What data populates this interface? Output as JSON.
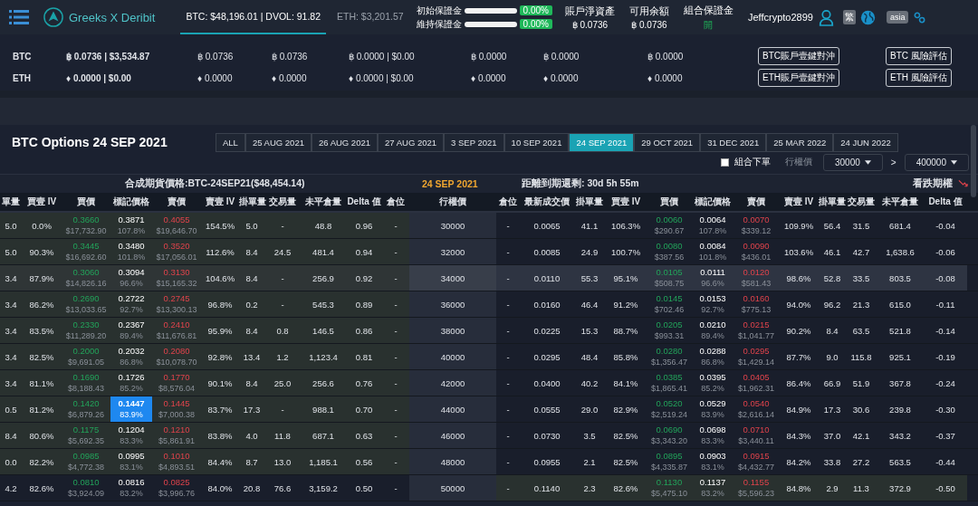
{
  "header": {
    "brand": "Greeks X Deribit",
    "tickers": [
      {
        "label": "BTC: $48,196.01 | DVOL: 91.82",
        "selected": true
      },
      {
        "label": "ETH: $3,201.57",
        "selected": false
      }
    ],
    "margins": [
      {
        "label": "初始保證金",
        "level": 0,
        "value": "0.00%"
      },
      {
        "label": "維持保證金",
        "level": 0,
        "value": "0.00%"
      }
    ],
    "stats": [
      {
        "label": "賬戶淨資產",
        "value": "฿ 0.0736",
        "kind": "plain"
      },
      {
        "label": "可用余額",
        "value": "฿ 0.0736",
        "kind": "plain"
      },
      {
        "label": "組合保證金",
        "value": "開",
        "kind": "status"
      }
    ],
    "user": "Jeffcrypto2899",
    "language": "繁",
    "region": "asia"
  },
  "accounts": [
    {
      "currency": "BTC",
      "cells": [
        "฿ 0.0736 | $3,534.87",
        "฿ 0.0736",
        "฿ 0.0736",
        "฿ 0.0000 | $0.00",
        "฿ 0.0000",
        "฿ 0.0000",
        "฿ 0.0000"
      ],
      "buttons": [
        "BTC賬戶壹鍵對沖",
        "BTC 風險評估"
      ]
    },
    {
      "currency": "ETH",
      "cells": [
        "♦ 0.0000 | $0.00",
        "♦ 0.0000",
        "♦ 0.0000",
        "♦ 0.0000 | $0.00",
        "♦ 0.0000",
        "♦ 0.0000",
        "♦ 0.0000"
      ],
      "buttons": [
        "ETH賬戶壹鍵對沖",
        "ETH 風險評估"
      ]
    }
  ],
  "options": {
    "title": "BTC Options 24 SEP 2021",
    "expiries": [
      {
        "label": "ALL",
        "selected": false
      },
      {
        "label": "25 AUG 2021",
        "selected": false
      },
      {
        "label": "26 AUG 2021",
        "selected": false
      },
      {
        "label": "27 AUG 2021",
        "selected": false
      },
      {
        "label": "3 SEP 2021",
        "selected": false
      },
      {
        "label": "10 SEP 2021",
        "selected": false
      },
      {
        "label": "24 SEP 2021",
        "selected": true
      },
      {
        "label": "29 OCT 2021",
        "selected": false
      },
      {
        "label": "31 DEC 2021",
        "selected": false
      },
      {
        "label": "25 MAR 2022",
        "selected": false
      },
      {
        "label": "24 JUN 2022",
        "selected": false
      }
    ],
    "combo": {
      "label": "組合下單",
      "checked": false
    },
    "strike_label": "行權價",
    "strike_from": "30000",
    "separator": ">",
    "strike_to": "400000",
    "futures": "合成期貨價格:BTC-24SEP21($48,454.14)",
    "expiry": "24 SEP 2021",
    "countdown": "距離到期還剩: 30d 5h 55m",
    "puts_label": "看跌期權",
    "call_columns": [
      "單量",
      "買壹 IV",
      "買價",
      "標記價格",
      "賣價",
      "賣壹 IV",
      "掛單量",
      "交易量",
      "未平倉量",
      "Delta 值",
      "倉位"
    ],
    "strike_column": "行權價",
    "put_columns": [
      "倉位",
      "最新成交價",
      "掛單量",
      "買壹 IV",
      "買價",
      "標記價格",
      "賣價",
      "賣壹 IV",
      "掛單量",
      "交易量",
      "未平倉量",
      "Delta 值"
    ],
    "rows": [
      {
        "strike": "30000",
        "call_itm": true,
        "put_itm": false,
        "hovered": false,
        "call_mark_selected": false,
        "call": [
          "5.0",
          "0.0%",
          {
            "price": "0.3660",
            "sub": "$17,732.90"
          },
          {
            "price": "0.3871",
            "sub": "107.8%"
          },
          {
            "price": "0.4055",
            "sub": "$19,646.70"
          },
          "154.5%",
          "5.0",
          "-",
          "48.8",
          "0.96",
          "-"
        ],
        "put": [
          "-",
          "0.0065",
          "41.1",
          "106.3%",
          {
            "price": "0.0060",
            "sub": "$290.67"
          },
          {
            "price": "0.0064",
            "sub": "107.8%"
          },
          {
            "price": "0.0070",
            "sub": "$339.12"
          },
          "109.9%",
          "56.4",
          "31.5",
          "681.4",
          "-0.04"
        ]
      },
      {
        "strike": "32000",
        "call_itm": true,
        "put_itm": false,
        "hovered": false,
        "call_mark_selected": false,
        "call": [
          "5.0",
          "90.3%",
          {
            "price": "0.3445",
            "sub": "$16,692.60"
          },
          {
            "price": "0.3480",
            "sub": "101.8%"
          },
          {
            "price": "0.3520",
            "sub": "$17,056.01"
          },
          "112.6%",
          "8.4",
          "24.5",
          "481.4",
          "0.94",
          "-"
        ],
        "put": [
          "-",
          "0.0085",
          "24.9",
          "100.7%",
          {
            "price": "0.0080",
            "sub": "$387.56"
          },
          {
            "price": "0.0084",
            "sub": "101.8%"
          },
          {
            "price": "0.0090",
            "sub": "$436.01"
          },
          "103.6%",
          "46.1",
          "42.7",
          "1,638.6",
          "-0.06"
        ]
      },
      {
        "strike": "34000",
        "call_itm": true,
        "put_itm": false,
        "hovered": true,
        "call_mark_selected": false,
        "call": [
          "3.4",
          "87.9%",
          {
            "price": "0.3060",
            "sub": "$14,826.16"
          },
          {
            "price": "0.3094",
            "sub": "96.6%"
          },
          {
            "price": "0.3130",
            "sub": "$15,165.32"
          },
          "104.6%",
          "8.4",
          "-",
          "256.9",
          "0.92",
          "-"
        ],
        "put": [
          "-",
          "0.0110",
          "55.3",
          "95.1%",
          {
            "price": "0.0105",
            "sub": "$508.75"
          },
          {
            "price": "0.0111",
            "sub": "96.6%"
          },
          {
            "price": "0.0120",
            "sub": "$581.43"
          },
          "98.6%",
          "52.8",
          "33.5",
          "803.5",
          "-0.08"
        ]
      },
      {
        "strike": "36000",
        "call_itm": true,
        "put_itm": false,
        "hovered": false,
        "call_mark_selected": false,
        "call": [
          "3.4",
          "86.2%",
          {
            "price": "0.2690",
            "sub": "$13,033.65"
          },
          {
            "price": "0.2722",
            "sub": "92.7%"
          },
          {
            "price": "0.2745",
            "sub": "$13,300.13"
          },
          "96.8%",
          "0.2",
          "-",
          "545.3",
          "0.89",
          "-"
        ],
        "put": [
          "-",
          "0.0160",
          "46.4",
          "91.2%",
          {
            "price": "0.0145",
            "sub": "$702.46"
          },
          {
            "price": "0.0153",
            "sub": "92.7%"
          },
          {
            "price": "0.0160",
            "sub": "$775.13"
          },
          "94.0%",
          "96.2",
          "21.3",
          "615.0",
          "-0.11"
        ]
      },
      {
        "strike": "38000",
        "call_itm": true,
        "put_itm": false,
        "hovered": false,
        "call_mark_selected": false,
        "call": [
          "3.4",
          "83.5%",
          {
            "price": "0.2330",
            "sub": "$11,289.20"
          },
          {
            "price": "0.2367",
            "sub": "89.4%"
          },
          {
            "price": "0.2410",
            "sub": "$11,676.81"
          },
          "95.9%",
          "8.4",
          "0.8",
          "146.5",
          "0.86",
          "-"
        ],
        "put": [
          "-",
          "0.0225",
          "15.3",
          "88.7%",
          {
            "price": "0.0205",
            "sub": "$993.31"
          },
          {
            "price": "0.0210",
            "sub": "89.4%"
          },
          {
            "price": "0.0215",
            "sub": "$1,041.77"
          },
          "90.2%",
          "8.4",
          "63.5",
          "521.8",
          "-0.14"
        ]
      },
      {
        "strike": "40000",
        "call_itm": true,
        "put_itm": false,
        "hovered": false,
        "call_mark_selected": false,
        "call": [
          "3.4",
          "82.5%",
          {
            "price": "0.2000",
            "sub": "$9,691.05"
          },
          {
            "price": "0.2032",
            "sub": "86.8%"
          },
          {
            "price": "0.2080",
            "sub": "$10,078.70"
          },
          "92.8%",
          "13.4",
          "1.2",
          "1,123.4",
          "0.81",
          "-"
        ],
        "put": [
          "-",
          "0.0295",
          "48.4",
          "85.8%",
          {
            "price": "0.0280",
            "sub": "$1,356.47"
          },
          {
            "price": "0.0288",
            "sub": "86.8%"
          },
          {
            "price": "0.0295",
            "sub": "$1,429.14"
          },
          "87.7%",
          "9.0",
          "115.8",
          "925.1",
          "-0.19"
        ]
      },
      {
        "strike": "42000",
        "call_itm": true,
        "put_itm": false,
        "hovered": false,
        "call_mark_selected": false,
        "call": [
          "3.4",
          "81.1%",
          {
            "price": "0.1690",
            "sub": "$8,188.43"
          },
          {
            "price": "0.1726",
            "sub": "85.2%"
          },
          {
            "price": "0.1770",
            "sub": "$8,576.04"
          },
          "90.1%",
          "8.4",
          "25.0",
          "256.6",
          "0.76",
          "-"
        ],
        "put": [
          "-",
          "0.0400",
          "40.2",
          "84.1%",
          {
            "price": "0.0385",
            "sub": "$1,865.41"
          },
          {
            "price": "0.0395",
            "sub": "85.2%"
          },
          {
            "price": "0.0405",
            "sub": "$1,962.31"
          },
          "86.4%",
          "66.9",
          "51.9",
          "367.8",
          "-0.24"
        ]
      },
      {
        "strike": "44000",
        "call_itm": true,
        "put_itm": false,
        "hovered": false,
        "call_mark_selected": true,
        "call": [
          "0.5",
          "81.2%",
          {
            "price": "0.1420",
            "sub": "$6,879.26"
          },
          {
            "price": "0.1447",
            "sub": "83.9%"
          },
          {
            "price": "0.1445",
            "sub": "$7,000.38"
          },
          "83.7%",
          "17.3",
          "-",
          "988.1",
          "0.70",
          "-"
        ],
        "put": [
          "-",
          "0.0555",
          "29.0",
          "82.9%",
          {
            "price": "0.0520",
            "sub": "$2,519.24"
          },
          {
            "price": "0.0529",
            "sub": "83.9%"
          },
          {
            "price": "0.0540",
            "sub": "$2,616.14"
          },
          "84.9%",
          "17.3",
          "30.6",
          "239.8",
          "-0.30"
        ]
      },
      {
        "strike": "46000",
        "call_itm": true,
        "put_itm": false,
        "hovered": false,
        "call_mark_selected": false,
        "call": [
          "8.4",
          "80.6%",
          {
            "price": "0.1175",
            "sub": "$5,692.35"
          },
          {
            "price": "0.1204",
            "sub": "83.3%"
          },
          {
            "price": "0.1210",
            "sub": "$5,861.91"
          },
          "83.8%",
          "4.0",
          "11.8",
          "687.1",
          "0.63",
          "-"
        ],
        "put": [
          "-",
          "0.0730",
          "3.5",
          "82.5%",
          {
            "price": "0.0690",
            "sub": "$3,343.20"
          },
          {
            "price": "0.0698",
            "sub": "83.3%"
          },
          {
            "price": "0.0710",
            "sub": "$3,440.11"
          },
          "84.3%",
          "37.0",
          "42.1",
          "343.2",
          "-0.37"
        ]
      },
      {
        "strike": "48000",
        "call_itm": true,
        "put_itm": false,
        "hovered": false,
        "call_mark_selected": false,
        "call": [
          "0.0",
          "82.2%",
          {
            "price": "0.0985",
            "sub": "$4,772.38"
          },
          {
            "price": "0.0995",
            "sub": "83.1%"
          },
          {
            "price": "0.1010",
            "sub": "$4,893.51"
          },
          "84.4%",
          "8.7",
          "13.0",
          "1,185.1",
          "0.56",
          "-"
        ],
        "put": [
          "-",
          "0.0955",
          "2.1",
          "82.5%",
          {
            "price": "0.0895",
            "sub": "$4,335.87"
          },
          {
            "price": "0.0903",
            "sub": "83.1%"
          },
          {
            "price": "0.0915",
            "sub": "$4,432.77"
          },
          "84.2%",
          "33.8",
          "27.2",
          "563.5",
          "-0.44"
        ]
      },
      {
        "strike": "50000",
        "call_itm": false,
        "put_itm": true,
        "hovered": false,
        "call_mark_selected": false,
        "call": [
          "4.2",
          "82.6%",
          {
            "price": "0.0810",
            "sub": "$3,924.09"
          },
          {
            "price": "0.0816",
            "sub": "83.2%"
          },
          {
            "price": "0.0825",
            "sub": "$3,996.76"
          },
          "84.0%",
          "20.8",
          "76.6",
          "3,159.2",
          "0.50",
          "-"
        ],
        "put": [
          "-",
          "0.1140",
          "2.3",
          "82.6%",
          {
            "price": "0.1130",
            "sub": "$5,475.10"
          },
          {
            "price": "0.1137",
            "sub": "83.2%"
          },
          {
            "price": "0.1155",
            "sub": "$5,596.23"
          },
          "84.8%",
          "2.9",
          "11.3",
          "372.9",
          "-0.50"
        ]
      }
    ]
  }
}
